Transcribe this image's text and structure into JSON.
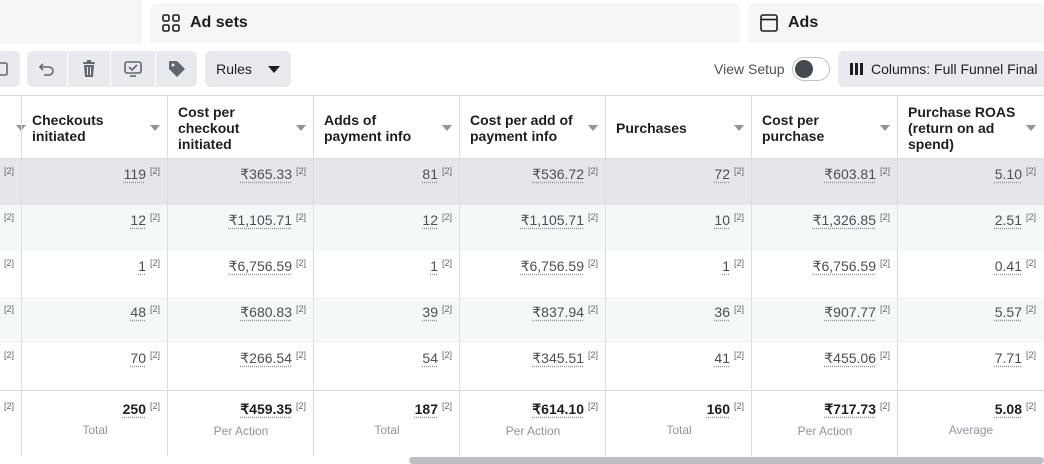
{
  "tabs": {
    "adsets_label": "Ad sets",
    "ads_label": "Ads"
  },
  "toolbar": {
    "rules_label": "Rules",
    "view_setup_label": "View Setup",
    "columns_label": "Columns: Full Funnel Final"
  },
  "table": {
    "headers": {
      "checkouts": "Checkouts initiated",
      "cost_checkout": "Cost per checkout initiated",
      "adds_payment": "Adds of payment info",
      "cost_add_payment": "Cost per add of payment info",
      "purchases": "Purchases",
      "cost_purchase": "Cost per purchase",
      "roas": "Purchase ROAS (return on ad spend)"
    },
    "footnote": "[2]",
    "rows": [
      {
        "checkouts": "119",
        "cost_checkout": "₹365.33",
        "adds_payment": "81",
        "cost_add_payment": "₹536.72",
        "purchases": "72",
        "cost_purchase": "₹603.81",
        "roas": "5.10"
      },
      {
        "checkouts": "12",
        "cost_checkout": "₹1,105.71",
        "adds_payment": "12",
        "cost_add_payment": "₹1,105.71",
        "purchases": "10",
        "cost_purchase": "₹1,326.85",
        "roas": "2.51"
      },
      {
        "checkouts": "1",
        "cost_checkout": "₹6,756.59",
        "adds_payment": "1",
        "cost_add_payment": "₹6,756.59",
        "purchases": "1",
        "cost_purchase": "₹6,756.59",
        "roas": "0.41"
      },
      {
        "checkouts": "48",
        "cost_checkout": "₹680.83",
        "adds_payment": "39",
        "cost_add_payment": "₹837.94",
        "purchases": "36",
        "cost_purchase": "₹907.77",
        "roas": "5.57"
      },
      {
        "checkouts": "70",
        "cost_checkout": "₹266.54",
        "adds_payment": "54",
        "cost_add_payment": "₹345.51",
        "purchases": "41",
        "cost_purchase": "₹455.06",
        "roas": "7.71"
      }
    ],
    "totals": {
      "checkouts": "250",
      "checkouts_lbl": "Total",
      "cost_checkout": "₹459.35",
      "cost_checkout_lbl": "Per Action",
      "adds_payment": "187",
      "adds_payment_lbl": "Total",
      "cost_add_payment": "₹614.10",
      "cost_add_payment_lbl": "Per Action",
      "purchases": "160",
      "purchases_lbl": "Total",
      "cost_purchase": "₹717.73",
      "cost_purchase_lbl": "Per Action",
      "roas": "5.08",
      "roas_lbl": "Average"
    }
  },
  "colors": {
    "row_selected": "#e4e6e9",
    "row_alt": "#f5f8f8"
  }
}
